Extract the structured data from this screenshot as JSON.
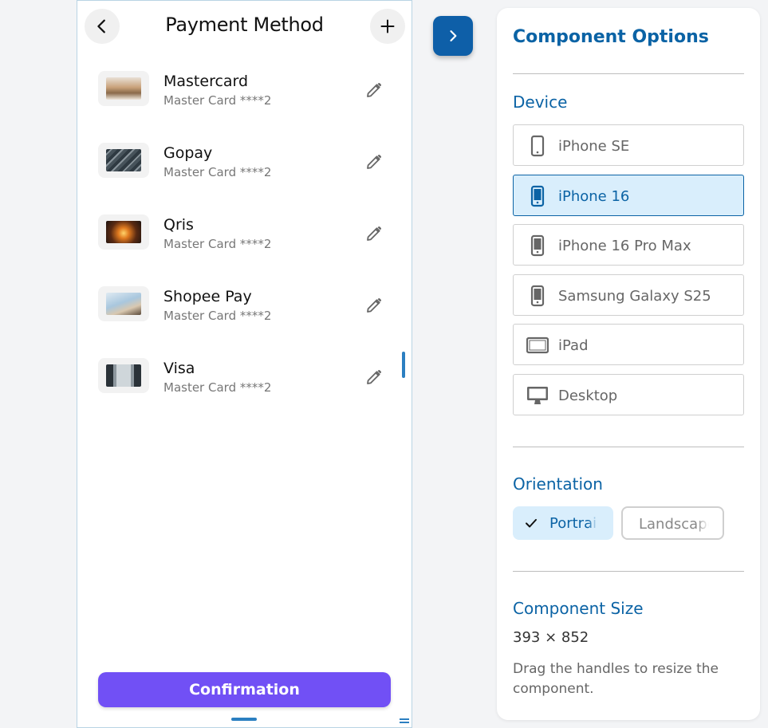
{
  "preview": {
    "title": "Payment Method",
    "back_icon": "chevron-left-icon",
    "add_icon": "plus-icon",
    "methods": [
      {
        "name": "Mastercard",
        "detail": "Master Card ****2",
        "thumb_color": "#c9a27a"
      },
      {
        "name": "Gopay",
        "detail": "Master Card ****2",
        "thumb_color": "#3e4a52"
      },
      {
        "name": "Qris",
        "detail": "Master Card ****2",
        "thumb_color": "#c7621f"
      },
      {
        "name": "Shopee Pay",
        "detail": "Master Card ****2",
        "thumb_color": "#a9c7de"
      },
      {
        "name": "Visa",
        "detail": "Master Card ****2",
        "thumb_color": "#4a5560"
      }
    ],
    "confirm_label": "Confirmation",
    "accent": "#7150f5"
  },
  "panel": {
    "title": "Component Options",
    "device_label": "Device",
    "devices": [
      {
        "label": "iPhone SE",
        "icon": "phone-icon",
        "selected": false
      },
      {
        "label": "iPhone 16",
        "icon": "phone-icon",
        "selected": true
      },
      {
        "label": "iPhone 16 Pro Max",
        "icon": "phone-icon",
        "selected": false
      },
      {
        "label": "Samsung Galaxy S25",
        "icon": "phone-icon",
        "selected": false
      },
      {
        "label": "iPad",
        "icon": "tablet-icon",
        "selected": false
      },
      {
        "label": "Desktop",
        "icon": "monitor-icon",
        "selected": false
      }
    ],
    "orientation_label": "Orientation",
    "orientation": {
      "portrait": "Portrait",
      "landscape": "Landscape",
      "selected": "Portrait"
    },
    "size_label": "Component Size",
    "size_value": "393 × 852",
    "size_hint": "Drag the handles to resize the component.",
    "accent": "#0b63a5"
  },
  "toggle_icon": "chevron-right-icon"
}
